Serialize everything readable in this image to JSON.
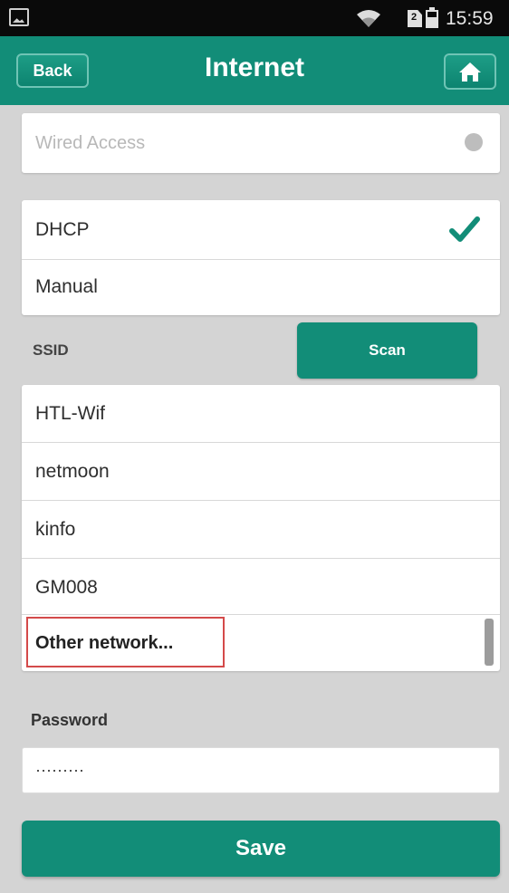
{
  "status_bar": {
    "time": "15:59",
    "sim_label": "2",
    "icons": [
      "image-icon",
      "wifi-icon",
      "sim-icon",
      "battery-icon"
    ]
  },
  "header": {
    "back_label": "Back",
    "title": "Internet",
    "home_icon": "home-icon"
  },
  "wired": {
    "label": "Wired Access",
    "toggle_state": "off"
  },
  "ip_mode": {
    "options": [
      {
        "label": "DHCP",
        "selected": true
      },
      {
        "label": "Manual",
        "selected": false
      }
    ]
  },
  "ssid": {
    "label": "SSID",
    "scan_label": "Scan",
    "networks": [
      "HTL-Wif",
      "netmoon",
      "kinfo",
      "GM008"
    ],
    "other_label": "Other network..."
  },
  "password": {
    "label": "Password",
    "value": "·········"
  },
  "save_label": "Save",
  "colors": {
    "accent": "#128d78",
    "background": "#d4d4d4",
    "highlight_border": "#d44a4a"
  }
}
